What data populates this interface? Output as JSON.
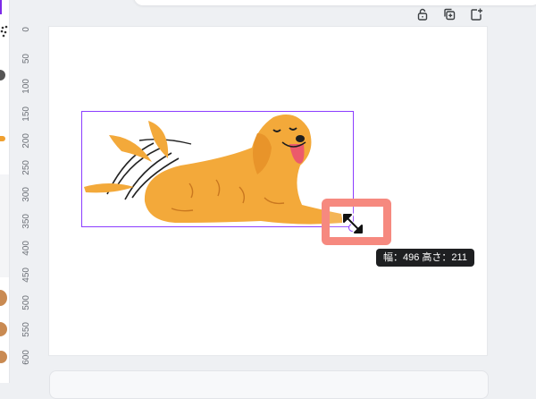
{
  "ruler": {
    "ticks": [
      "0",
      "50",
      "100",
      "150",
      "200",
      "250",
      "300",
      "350",
      "400",
      "450",
      "500",
      "550",
      "600"
    ]
  },
  "toolbar": {
    "lock_icon": "lock-open-icon",
    "duplicate_icon": "duplicate-icon",
    "add_page_icon": "add-page-icon"
  },
  "selection": {
    "tooltip": "幅：496 高さ：211"
  },
  "colors": {
    "selection": "#8b3dff",
    "highlight": "#f6897f",
    "dog": "#f3a93a",
    "tooltip_bg": "#1e1f21"
  }
}
